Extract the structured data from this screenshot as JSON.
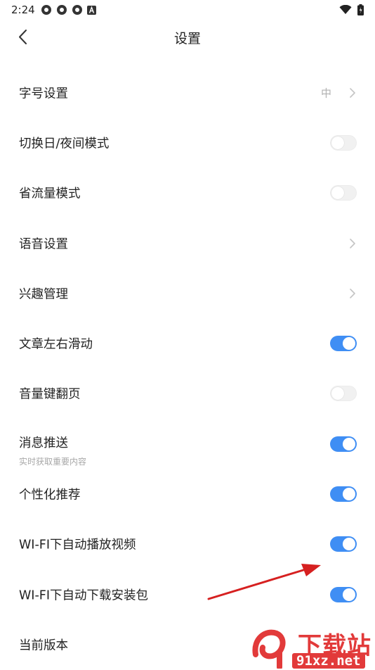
{
  "status_bar": {
    "time": "2:24",
    "notification_icons": [
      "app-icon",
      "app-icon",
      "app-icon",
      "a-icon"
    ],
    "right_icons": [
      "wifi-icon",
      "battery-icon"
    ]
  },
  "header": {
    "title": "设置"
  },
  "settings": [
    {
      "label": "字号设置",
      "control": "chevron",
      "value": "中"
    },
    {
      "label": "切换日/夜间模式",
      "control": "toggle",
      "on": false
    },
    {
      "label": "省流量模式",
      "control": "toggle",
      "on": false
    },
    {
      "label": "语音设置",
      "control": "chevron"
    },
    {
      "label": "兴趣管理",
      "control": "chevron"
    },
    {
      "label": "文章左右滑动",
      "control": "toggle",
      "on": true
    },
    {
      "label": "音量键翻页",
      "control": "toggle",
      "on": false
    },
    {
      "label": "消息推送",
      "sublabel": "实时获取重要内容",
      "control": "toggle",
      "on": true
    },
    {
      "label": "个性化推荐",
      "control": "toggle",
      "on": true
    },
    {
      "label": "WI-FI下自动播放视频",
      "control": "toggle",
      "on": true
    },
    {
      "label": "WI-FI下自动下载安装包",
      "control": "toggle",
      "on": true
    },
    {
      "label": "当前版本",
      "control": "none"
    }
  ],
  "watermark": {
    "text_large": "下载站",
    "text_small": "91xz.net"
  },
  "colors": {
    "accent": "#3f8ef4",
    "annotation_arrow": "#d62020",
    "watermark": "#e23a3a"
  }
}
